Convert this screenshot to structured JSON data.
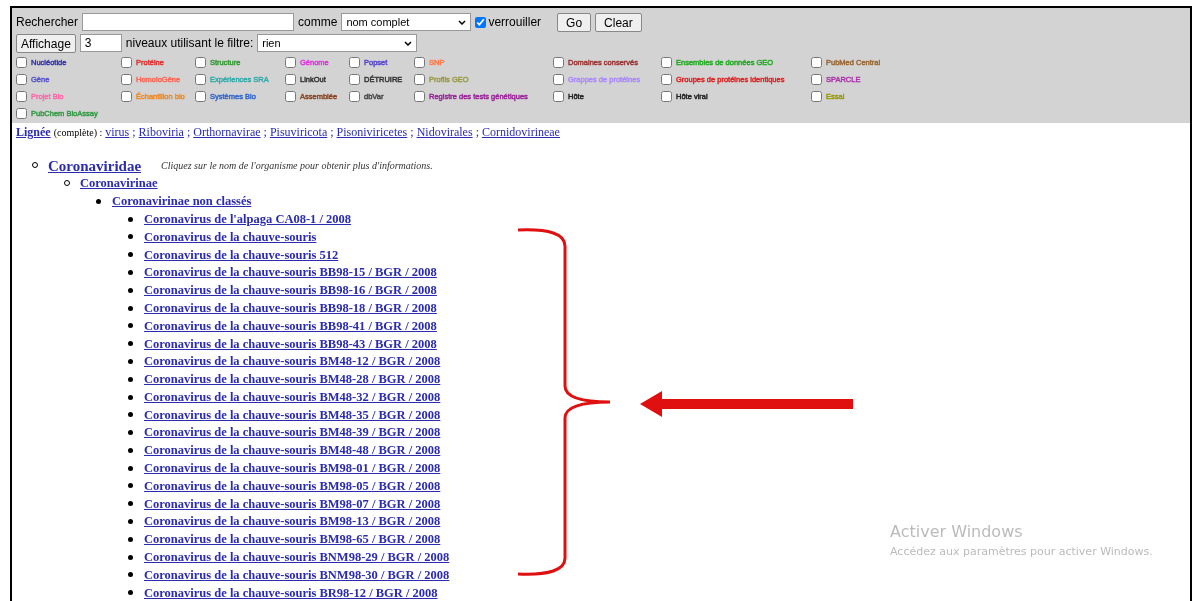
{
  "search": {
    "label": "Rechercher",
    "as_label": "comme",
    "mode": "nom complet",
    "lock": {
      "label": "verrouiller",
      "checked": true
    },
    "buttons": [
      "Go",
      "Clear"
    ]
  },
  "display": {
    "button": "Affichage",
    "levels": "3",
    "filter_label": "niveaux utilisant le filtre:",
    "filter": "rien"
  },
  "databases": [
    [
      {
        "label": "Nucléotide",
        "checked": false,
        "color": "#3333aa"
      },
      {
        "label": "Protéine",
        "checked": false,
        "color": "#e03030"
      },
      {
        "label": "Structure",
        "checked": false,
        "color": "#339933"
      },
      {
        "label": "Génome",
        "checked": false,
        "color": "#dd33dd"
      },
      {
        "label": "Popset",
        "checked": false,
        "color": "#5544cc"
      },
      {
        "label": "SNP",
        "checked": false,
        "color": "#ff7744"
      },
      {
        "label": "Domaines conservés",
        "checked": false,
        "color": "#993333"
      },
      {
        "label": "Ensembles de données GEO",
        "checked": false,
        "color": "#22aa22"
      },
      {
        "label": "PubMed Central",
        "checked": false,
        "color": "#996633"
      }
    ],
    [
      {
        "label": "Gène",
        "checked": false,
        "color": "#5555cc"
      },
      {
        "label": "HomoloGène",
        "checked": false,
        "color": "#ff6655"
      },
      {
        "label": "Expériences SRA",
        "checked": false,
        "color": "#33aaaa"
      },
      {
        "label": "LinkOut",
        "checked": false,
        "color": "#333333"
      },
      {
        "label": "DÉTRUIRE",
        "checked": false,
        "color": "#333333"
      },
      {
        "label": "Profils GEO",
        "checked": false,
        "color": "#999944"
      },
      {
        "label": "Grappes de protéines",
        "checked": false,
        "color": "#aa88ff"
      },
      {
        "label": "Groupes de protéines identiques",
        "checked": false,
        "color": "#dd2222"
      },
      {
        "label": "SPARCLE",
        "checked": false,
        "color": "#aa33aa"
      }
    ],
    [
      {
        "label": "Projet Bio",
        "checked": false,
        "color": "#ff66aa"
      },
      {
        "label": "Échantillon bio",
        "checked": false,
        "color": "#ee8822"
      },
      {
        "label": "Systèmes Bio",
        "checked": false,
        "color": "#3366cc"
      },
      {
        "label": "Assemblée",
        "checked": false,
        "color": "#884422"
      },
      {
        "label": "dbVar",
        "checked": false,
        "color": "#444444"
      },
      {
        "label": "Registre des tests génétiques",
        "checked": false,
        "color": "#992299"
      },
      {
        "label": "Hôte",
        "checked": false,
        "color": "#222222"
      },
      {
        "label": "Hôte viral",
        "checked": false,
        "color": "#222222"
      },
      {
        "label": "Essai",
        "checked": false,
        "color": "#999900"
      }
    ],
    [
      {
        "label": "PubChem BioAssay",
        "checked": false,
        "color": "#339944"
      }
    ]
  ],
  "lineage": {
    "label": "Lignée",
    "note": "(complète) :",
    "separator": ";",
    "items": [
      "virus",
      "Riboviria",
      "Orthornavirae",
      "Pisuviricota",
      "Pisoniviricetes",
      "Nidovirales",
      "Cornidovirineae"
    ]
  },
  "tree": {
    "name": "Coronaviridae",
    "hint": "Cliquez sur le nom de l'organisme pour obtenir plus d'informations.",
    "children": [
      {
        "name": "Coronavirinae",
        "children": [
          {
            "name": "Coronavirinae non classés",
            "children": [
              {
                "name": "Coronavirus de l'alpaga CA08-1 / 2008"
              },
              {
                "name": "Coronavirus de la chauve-souris"
              },
              {
                "name": "Coronavirus de la chauve-souris 512"
              },
              {
                "name": "Coronavirus de la chauve-souris BB98-15 / BGR / 2008"
              },
              {
                "name": "Coronavirus de la chauve-souris BB98-16 / BGR / 2008"
              },
              {
                "name": "Coronavirus de la chauve-souris BB98-18 / BGR / 2008"
              },
              {
                "name": "Coronavirus de la chauve-souris BB98-41 / BGR / 2008"
              },
              {
                "name": "Coronavirus de la chauve-souris BB98-43 / BGR / 2008"
              },
              {
                "name": "Coronavirus de la chauve-souris BM48-12 / BGR / 2008"
              },
              {
                "name": "Coronavirus de la chauve-souris BM48-28 / BGR / 2008"
              },
              {
                "name": "Coronavirus de la chauve-souris BM48-32 / BGR / 2008"
              },
              {
                "name": "Coronavirus de la chauve-souris BM48-35 / BGR / 2008"
              },
              {
                "name": "Coronavirus de la chauve-souris BM48-39 / BGR / 2008"
              },
              {
                "name": "Coronavirus de la chauve-souris BM48-48 / BGR / 2008"
              },
              {
                "name": "Coronavirus de la chauve-souris BM98-01 / BGR / 2008"
              },
              {
                "name": "Coronavirus de la chauve-souris BM98-05 / BGR / 2008"
              },
              {
                "name": "Coronavirus de la chauve-souris BM98-07 / BGR / 2008"
              },
              {
                "name": "Coronavirus de la chauve-souris BM98-13 / BGR / 2008"
              },
              {
                "name": "Coronavirus de la chauve-souris BM98-65 / BGR / 2008"
              },
              {
                "name": "Coronavirus de la chauve-souris BNM98-29 / BGR / 2008"
              },
              {
                "name": "Coronavirus de la chauve-souris BNM98-30 / BGR / 2008"
              },
              {
                "name": "Coronavirus de la chauve-souris BR98-12 / BGR / 2008"
              }
            ]
          }
        ]
      }
    ]
  },
  "activation": {
    "title": "Activer Windows",
    "text": "Accédez aux paramètres pour activer Windows."
  }
}
